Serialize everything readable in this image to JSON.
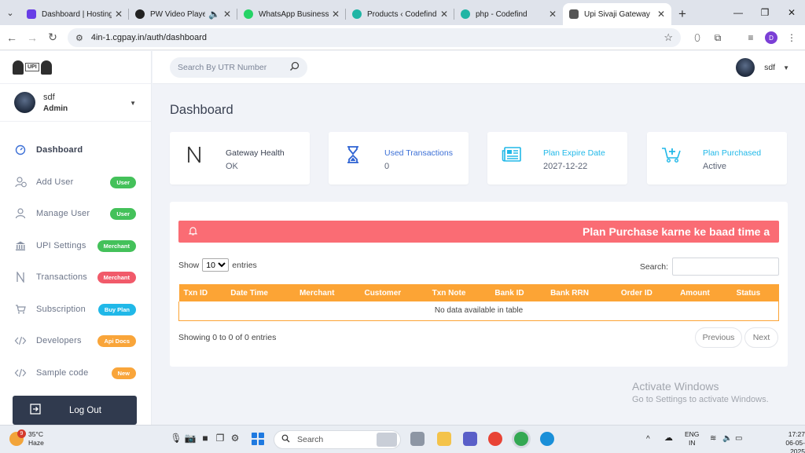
{
  "browser": {
    "tabs": [
      {
        "title": "Dashboard | Hosting",
        "icon": "hostinger-icon",
        "color": "#673de6"
      },
      {
        "title": "PW Video Player",
        "icon": "pw-icon",
        "color": "#222222"
      },
      {
        "title": "WhatsApp Business",
        "icon": "whatsapp-icon",
        "color": "#25d366"
      },
      {
        "title": "Products ‹ Codefind",
        "icon": "codefind-icon",
        "color": "#1fb5a5"
      },
      {
        "title": "php - Codefind",
        "icon": "codefind-icon",
        "color": "#1fb5a5"
      },
      {
        "title": "Upi Sivaji Gateway",
        "icon": "upi-icon",
        "color": "#555555"
      }
    ],
    "url": "4in-1.cgpay.in/auth/dashboard",
    "profile_initial": "D"
  },
  "sidebar": {
    "logo_text": "UPI",
    "user_name": "sdf",
    "user_role": "Admin",
    "menu": [
      {
        "label": "Dashboard",
        "icon": "dashboard-icon",
        "badge": "",
        "badge_color": ""
      },
      {
        "label": "Add User",
        "icon": "add-user-icon",
        "badge": "User",
        "badge_color": "#44c15a"
      },
      {
        "label": "Manage User",
        "icon": "user-icon",
        "badge": "User",
        "badge_color": "#44c15a"
      },
      {
        "label": "UPI Settings",
        "icon": "bank-icon",
        "badge": "Merchant",
        "badge_color": "#44c15a"
      },
      {
        "label": "Transactions",
        "icon": "transactions-icon",
        "badge": "Merchant",
        "badge_color": "#f15a6a"
      },
      {
        "label": "Subscription",
        "icon": "cart-icon",
        "badge": "Buy Plan",
        "badge_color": "#20b8e8"
      },
      {
        "label": "Developers",
        "icon": "code-icon",
        "badge": "Api Docs",
        "badge_color": "#f9a53a"
      },
      {
        "label": "Sample code",
        "icon": "code-icon",
        "badge": "New",
        "badge_color": "#f9a53a"
      }
    ],
    "logout_label": "Log Out"
  },
  "header": {
    "search_placeholder": "Search By UTR Number",
    "user_name": "sdf"
  },
  "main": {
    "title": "Dashboard",
    "cards": [
      {
        "title": "Gateway Health",
        "value": "OK",
        "icon": "gateway-icon",
        "title_color": "#3a4152",
        "icon_color": "#333333"
      },
      {
        "title": "Used Transactions",
        "value": "0",
        "icon": "hourglass-icon",
        "title_color": "#3b6fd6",
        "icon_color": "#2d62d3"
      },
      {
        "title": "Plan Expire Date",
        "value": "2027-12-22",
        "icon": "newspaper-icon",
        "title_color": "#20b8e8",
        "icon_color": "#20b8e8"
      },
      {
        "title": "Plan Purchased",
        "value": "Active",
        "icon": "cart-plus-icon",
        "title_color": "#20b8e8",
        "icon_color": "#20b8e8"
      }
    ],
    "alert_text": "Plan Purchase karne ke baad time a",
    "show_label": "Show",
    "entries_value": "10",
    "entries_label": "entries",
    "search_label": "Search:",
    "columns": [
      "Txn ID",
      "Date Time",
      "Merchant",
      "Customer",
      "Txn Note",
      "Bank ID",
      "Bank RRN",
      "Order ID",
      "Amount",
      "Status"
    ],
    "empty_text": "No data available in table",
    "info_text": "Showing 0 to 0 of 0 entries",
    "prev_label": "Previous",
    "next_label": "Next",
    "accent": "#fca435"
  },
  "watermark": {
    "line1": "Activate Windows",
    "line2": "Go to Settings to activate Windows."
  },
  "taskbar": {
    "temp": "35°C",
    "weather": "Haze",
    "weather_badge": "9",
    "search_label": "Search",
    "lang1": "ENG",
    "lang2": "IN",
    "time": "17:27",
    "date": "06-05-2025"
  }
}
